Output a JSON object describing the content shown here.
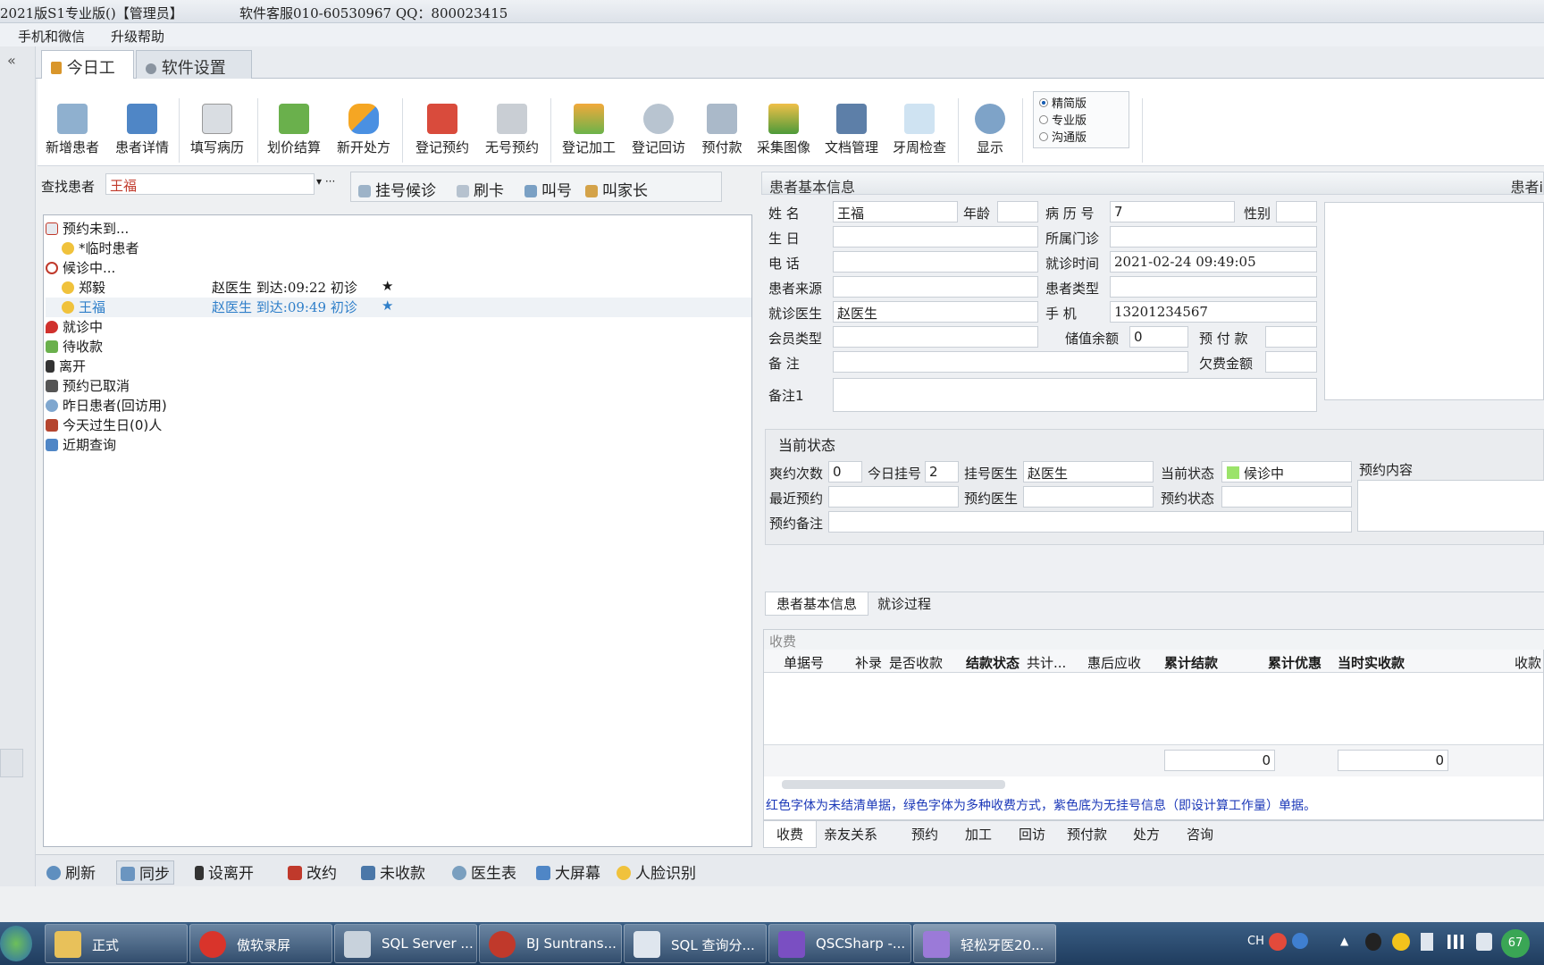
{
  "window": {
    "title": "2021版S1专业版()【管理员】",
    "support": "软件客服010-60530967  QQ：800023415"
  },
  "menu": [
    "手机和微信",
    "升级帮助"
  ],
  "tabs": [
    {
      "label": "今日工作"
    },
    {
      "label": "软件设置"
    }
  ],
  "ribbon": {
    "buttons": [
      "新增患者",
      "患者详情",
      "填写病历",
      "划价结算",
      "新开处方",
      "登记预约",
      "无号预约",
      "登记加工",
      "登记回访",
      "预付款",
      "采集图像",
      "文档管理",
      "牙周检查",
      "显示"
    ],
    "editions": [
      "精简版",
      "专业版",
      "沟通版"
    ]
  },
  "search": {
    "label": "查找患者",
    "value": "王福",
    "tools": [
      "挂号候诊",
      "刷卡",
      "叫号",
      "叫家长"
    ]
  },
  "tree": [
    {
      "label": "预约未到..."
    },
    {
      "label": "*临时患者",
      "child": true
    },
    {
      "label": "候诊中..."
    },
    {
      "label": "郑毅",
      "child": true,
      "info": "赵医生   到达:09:22 初诊",
      "star": "★"
    },
    {
      "label": "王福",
      "child": true,
      "info": "赵医生   到达:09:49 初诊",
      "star": "★",
      "selected": true
    },
    {
      "label": "就诊中"
    },
    {
      "label": "待收款"
    },
    {
      "label": "离开"
    },
    {
      "label": "预约已取消"
    },
    {
      "label": "昨日患者(回访用)"
    },
    {
      "label": "今天过生日(0)人"
    },
    {
      "label": "近期查询"
    }
  ],
  "patient": {
    "header": "患者基本信息",
    "header_right": "患者i",
    "name_label": "姓    名",
    "name": "王福",
    "age_label": "年龄",
    "record_label": "病 历 号",
    "record": "7",
    "gender_label": "性别",
    "birth_label": "生    日",
    "clinic_label": "所属门诊",
    "phone_label": "电    话",
    "visit_time_label": "就诊时间",
    "visit_time": "2021-02-24 09:49:05",
    "source_label": "患者来源",
    "type_label": "患者类型",
    "doctor_label": "就诊医生",
    "doctor": "赵医生",
    "mobile_label": "手    机",
    "mobile": "13201234567",
    "member_label": "会员类型",
    "balance_label": "储值余额",
    "balance": "0",
    "prepay_label": "预 付 款",
    "note_label": "备    注",
    "debt_label": "欠费金额",
    "note1_label": "备注1"
  },
  "status": {
    "header": "当前状态",
    "miss_label": "爽约次数",
    "miss": "0",
    "today_label": "今日挂号",
    "today": "2",
    "reg_doctor_label": "挂号医生",
    "reg_doctor": "赵医生",
    "current_label": "当前状态",
    "current": "候诊中",
    "appt_content_label": "预约内容",
    "last_appt_label": "最近预约",
    "appt_doctor_label": "预约医生",
    "appt_status_label": "预约状态",
    "appt_note_label": "预约备注"
  },
  "subtabs": [
    "患者基本信息",
    "就诊过程"
  ],
  "charges": {
    "header": "收费",
    "columns": [
      "单据号",
      "补录",
      "是否收款",
      "结款状态",
      "共计...",
      "惠后应收",
      "累计结款",
      "累计优惠",
      "当时实收款",
      "收款"
    ],
    "total1": "0",
    "total2": "0",
    "note": "红色字体为未结清单据，绿色字体为多种收费方式，紫色底为无挂号信息（即设计算工作量）单据。",
    "tabs": [
      "收费",
      "亲友关系",
      "预约",
      "加工",
      "回访",
      "预付款",
      "处方",
      "咨询"
    ]
  },
  "bottom": [
    "刷新",
    "同步",
    "设离开",
    "改约",
    "未收款",
    "医生表",
    "大屏幕",
    "人脸识别"
  ],
  "taskbar": {
    "items": [
      "正式",
      "傲软录屏",
      "SQL Server ...",
      "BJ Suntrans...",
      "SQL 查询分...",
      "QSCSharp -...",
      "轻松牙医20..."
    ],
    "lang": "CH",
    "badge": "67"
  }
}
